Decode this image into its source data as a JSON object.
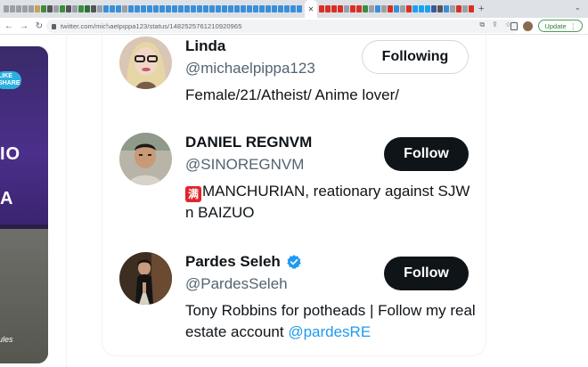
{
  "browser": {
    "url": "twitter.com/michaelpippa123/status/1482525761210920965",
    "update_label": "Update",
    "tab_colors": [
      "#9aa0a6",
      "#9aa0a6",
      "#9aa0a6",
      "#9aa0a6",
      "#9aa0a6",
      "#c8a25a",
      "#3c8d40",
      "#555",
      "#9aa0a6",
      "#3c8d40",
      "#555",
      "#9aa0a6",
      "#3c8d40",
      "#2f6f3a",
      "#555",
      "#9aa0a6",
      "#3a8fd8",
      "#3a8fd8",
      "#3a8fd8",
      "#9aa0a6",
      "#3a8fd8",
      "#3a8fd8",
      "#3a8fd8",
      "#3a8fd8",
      "#3a8fd8",
      "#3a8fd8",
      "#3a8fd8",
      "#3a8fd8",
      "#3a8fd8",
      "#3a8fd8",
      "#3a8fd8",
      "#3a8fd8",
      "#3a8fd8",
      "#3a8fd8",
      "#3a8fd8",
      "#3a8fd8",
      "#3a8fd8",
      "#3a8fd8",
      "#3a8fd8",
      "#3a8fd8",
      "#3a8fd8",
      "#3a8fd8",
      "#3a8fd8",
      "#3a8fd8",
      "#3a8fd8",
      "#3a8fd8",
      "#3a8fd8",
      "#3a8fd8"
    ],
    "tab_colors_right": [
      "#d93025",
      "#d93025",
      "#d93025",
      "#d93025",
      "#9aa0a6",
      "#d93025",
      "#d93025",
      "#3c8d40",
      "#9aa0a6",
      "#3a8fd8",
      "#9aa0a6",
      "#d93025",
      "#3a8fd8",
      "#9aa0a6",
      "#d93025",
      "#1da1f2",
      "#1da1f2",
      "#1da1f2",
      "#3b5998",
      "#555",
      "#3a8fd8",
      "#9aa0a6",
      "#d93025",
      "#9aa0a6",
      "#d93025"
    ]
  },
  "left_card": {
    "badge_text": "LIKE SHARE",
    "big_text_1": "IO",
    "big_text_2": "A",
    "caption": "ules"
  },
  "users": [
    {
      "name": "Linda",
      "handle": "@michaelpippa123",
      "bio": "Female/21/Atheist/ Anime lover/",
      "button": "Following",
      "verified": false
    },
    {
      "name": "DANIEL REGNVM",
      "handle": "@SINOREGNVM",
      "bio_flag": "满",
      "bio": "MANCHURIAN, reationary against SJW n BAIZUO",
      "button": "Follow",
      "verified": false
    },
    {
      "name": "Pardes Seleh",
      "handle": "@PardesSeleh",
      "bio": "Tony Robbins for potheads | Follow my real estate account ",
      "bio_link": "@pardesRE",
      "button": "Follow",
      "verified": true
    }
  ],
  "colors": {
    "accent": "#1d9bf0",
    "text_primary": "#0f1419",
    "text_secondary": "#536471",
    "follow_bg": "#0f1419"
  }
}
